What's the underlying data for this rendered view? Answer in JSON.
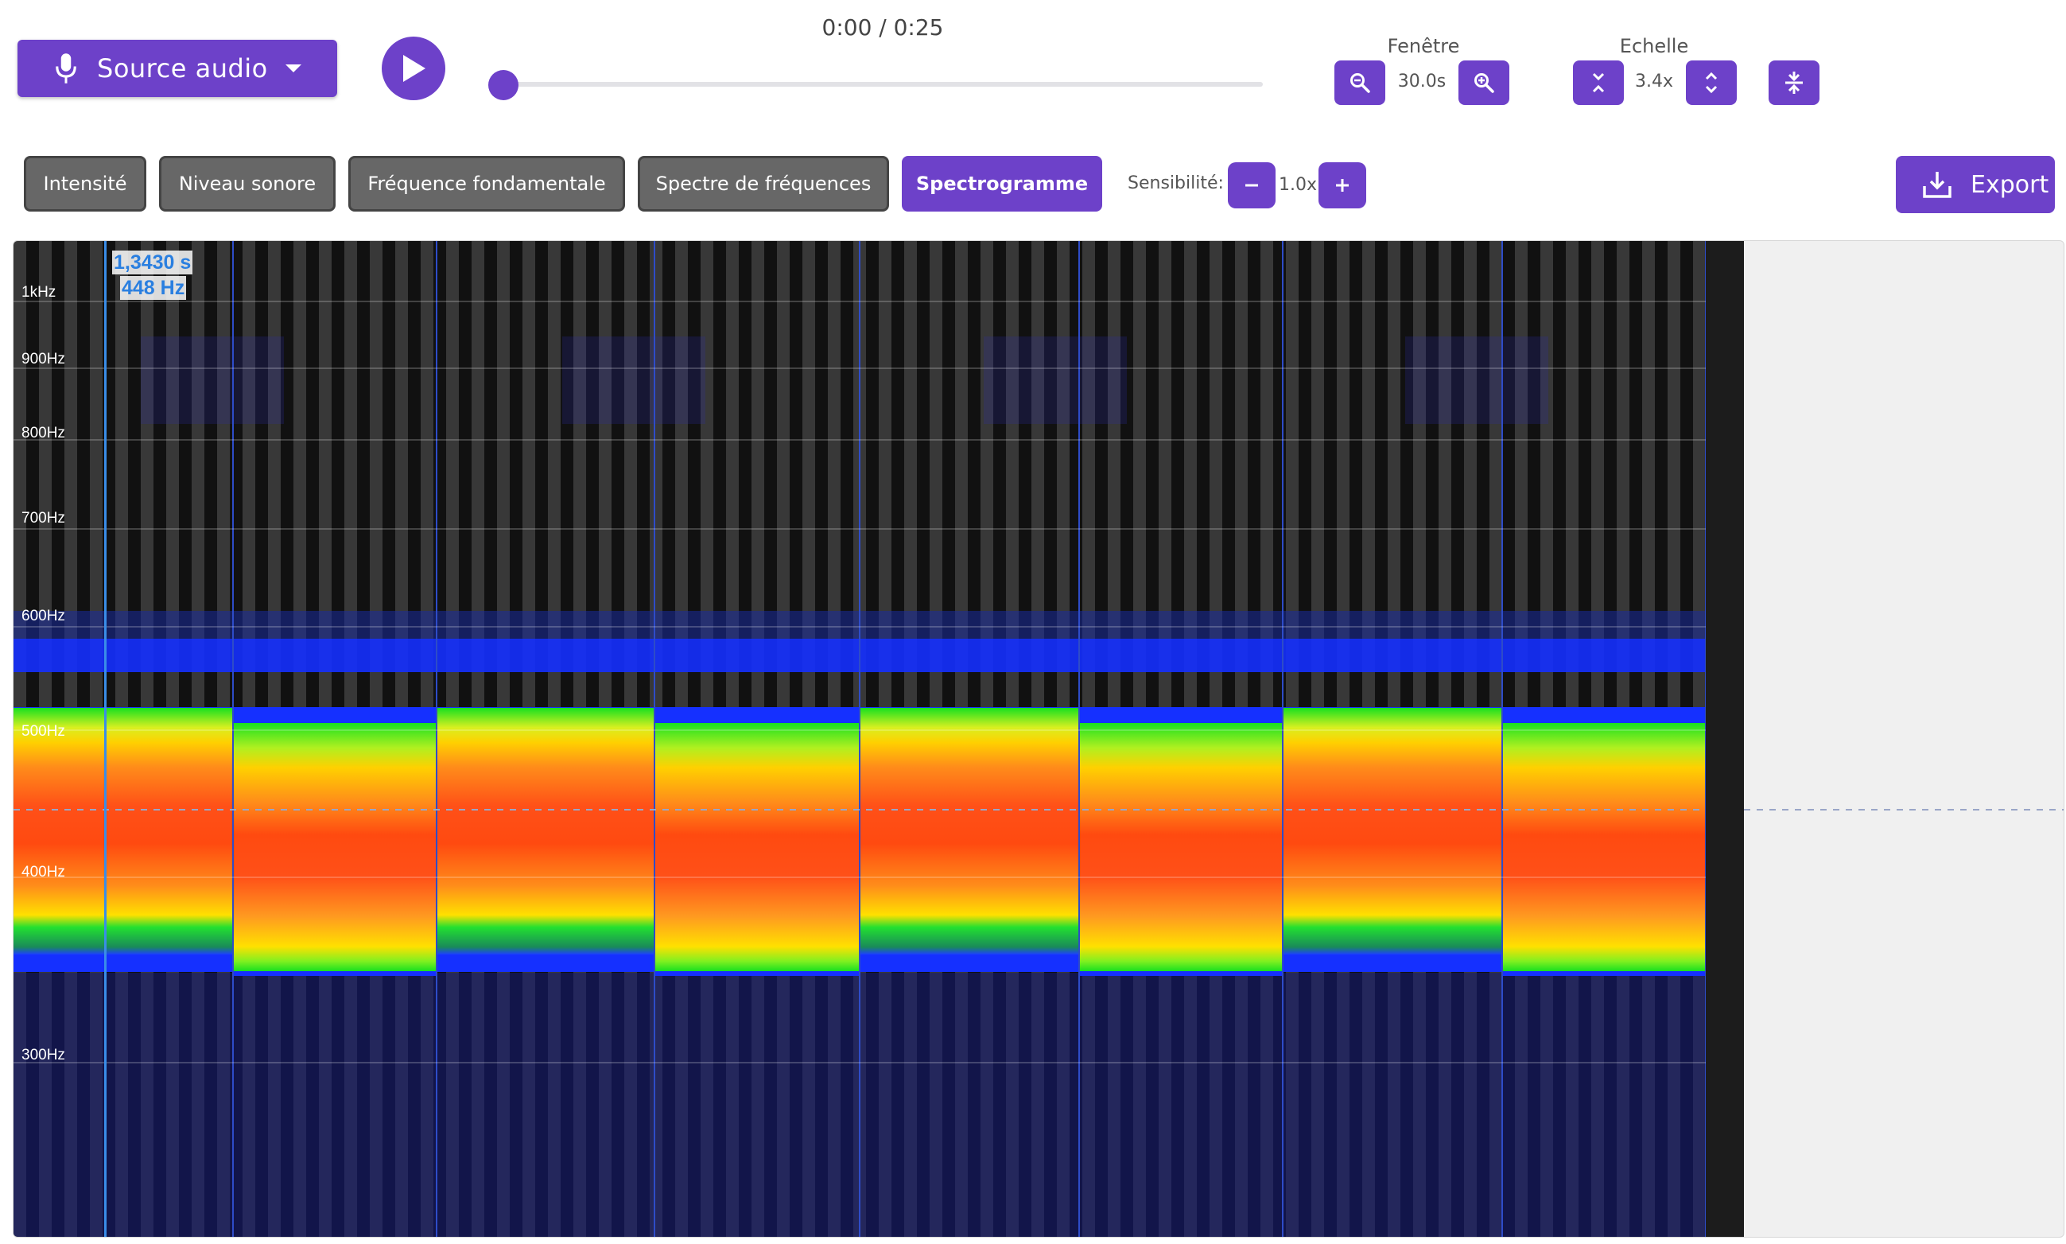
{
  "toolbar": {
    "source_label": "Source audio",
    "time_display": "0:00 / 0:25",
    "playback_progress": 0.0,
    "window_label": "Fenêtre",
    "window_value": "30.0s",
    "scale_label": "Echelle",
    "scale_value": "3.4x"
  },
  "tabs": [
    {
      "label": "Intensité",
      "active": false
    },
    {
      "label": "Niveau sonore",
      "active": false
    },
    {
      "label": "Fréquence fondamentale",
      "active": false
    },
    {
      "label": "Spectre de fréquences",
      "active": false
    },
    {
      "label": "Spectrogramme",
      "active": true
    }
  ],
  "sensitivity": {
    "label": "Sensibilité:",
    "value": "1.0x"
  },
  "export_label": "Export",
  "spectrogram": {
    "y_labels": [
      "1kHz",
      "900Hz",
      "800Hz",
      "700Hz",
      "600Hz",
      "500Hz",
      "400Hz",
      "300Hz"
    ],
    "cursor_time": "1,3430 s",
    "cursor_freq": "448 Hz"
  },
  "colors": {
    "accent": "#6d41c9",
    "cursor": "#3a8de8"
  }
}
